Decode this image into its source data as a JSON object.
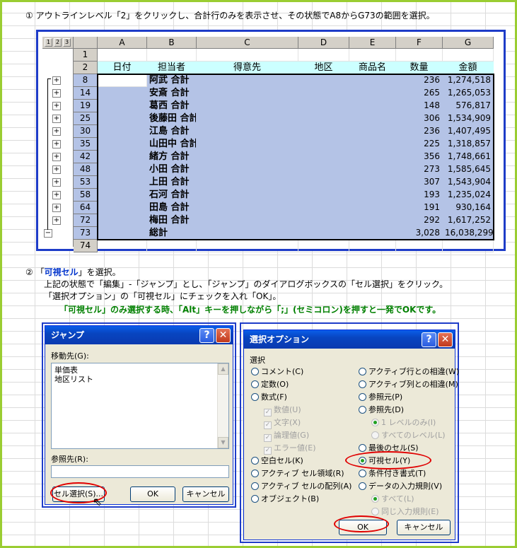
{
  "step1": {
    "num": "①",
    "text": "アウトラインレベル「2」をクリックし、合計行のみを表示させ、その状態でA8からG73の範囲を選択。"
  },
  "sheet": {
    "level_buttons": [
      "1",
      "2",
      "3"
    ],
    "columns": [
      "A",
      "B",
      "C",
      "D",
      "E",
      "F",
      "G"
    ],
    "header_row": {
      "row": "2",
      "cells": [
        "日付",
        "担当者",
        "得意先",
        "地区",
        "商品名",
        "数量",
        "金額"
      ]
    },
    "row1": "1",
    "rows": [
      {
        "row": "8",
        "name": "阿武 合計",
        "qty": "236",
        "amount": "1,274,518"
      },
      {
        "row": "14",
        "name": "安斎 合計",
        "qty": "265",
        "amount": "1,265,053"
      },
      {
        "row": "19",
        "name": "葛西 合計",
        "qty": "148",
        "amount": "576,817"
      },
      {
        "row": "25",
        "name": "後藤田 合計",
        "qty": "306",
        "amount": "1,534,909"
      },
      {
        "row": "30",
        "name": "江島 合計",
        "qty": "236",
        "amount": "1,407,495"
      },
      {
        "row": "35",
        "name": "山田中 合計",
        "qty": "225",
        "amount": "1,318,857"
      },
      {
        "row": "42",
        "name": "緒方 合計",
        "qty": "356",
        "amount": "1,748,661"
      },
      {
        "row": "48",
        "name": "小田 合計",
        "qty": "273",
        "amount": "1,585,645"
      },
      {
        "row": "53",
        "name": "上田 合計",
        "qty": "307",
        "amount": "1,543,904"
      },
      {
        "row": "58",
        "name": "石河 合計",
        "qty": "193",
        "amount": "1,235,024"
      },
      {
        "row": "64",
        "name": "田島 合計",
        "qty": "191",
        "amount": "930,164"
      },
      {
        "row": "72",
        "name": "梅田 合計",
        "qty": "292",
        "amount": "1,617,252"
      }
    ],
    "total_row": {
      "row": "73",
      "name": "総計",
      "qty": "3,028",
      "amount": "16,038,299"
    },
    "last_row": "74",
    "plus_symbol": "+",
    "minus_symbol": "−"
  },
  "step2": {
    "num": "②",
    "line1_pre": "「",
    "line1_em": "可視セル",
    "line1_post": "」を選択。",
    "line2": "上記の状態で「編集」-「ジャンプ」とし、「ジャンプ」のダイアログボックスの「セル選択」をクリック。",
    "line3": "「選択オプション」の「可視セル」にチェックを入れ「OK」。",
    "tip": "「可視セル」のみ選択する時、「Alt」キーを押しながら「;」(セミコロン)を押すと一発でOKです。"
  },
  "jump_dialog": {
    "title": "ジャンプ",
    "help": "?",
    "close": "✕",
    "goto_label": "移動先(G):",
    "list_items": [
      "単価表",
      "地区リスト"
    ],
    "ref_label": "参照先(R):",
    "ref_value": "",
    "select_button": "セル選択(S)...",
    "ok_button": "OK",
    "cancel_button": "キャンセル"
  },
  "select_dialog": {
    "title": "選択オプション",
    "help": "?",
    "close": "✕",
    "group_label": "選択",
    "left_options": [
      "コメント(C)",
      "定数(O)",
      "数式(F)"
    ],
    "formula_checks": [
      "数値(U)",
      "文字(X)",
      "論理値(G)",
      "エラー値(E)"
    ],
    "left_options2": [
      "空白セル(K)",
      "アクティブ セル領域(R)",
      "アクティブ セルの配列(A)",
      "オブジェクト(B)"
    ],
    "right_options": [
      "アクティブ行との相違(W)",
      "アクティブ列との相違(M)",
      "参照元(P)",
      "参照先(D)"
    ],
    "dep_options": [
      "1 レベルのみ(I)",
      "すべてのレベル(L)"
    ],
    "right_options2": [
      "最後のセル(S)",
      "可視セル(Y)",
      "条件付き書式(T)",
      "データの入力規則(V)"
    ],
    "valid_options": [
      "すべて(L)",
      "同じ入力規則(E)"
    ],
    "ok_button": "OK",
    "cancel_button": "キャンセル"
  },
  "colors": {
    "selection": "#b4c3e6",
    "header_fill": "#ccffff",
    "frame": "#9acd32",
    "blue_border": "#1e3cc8",
    "highlight_ellipse": "#e00000",
    "tip_text": "#008000",
    "emphasis_text": "#0033cc"
  }
}
